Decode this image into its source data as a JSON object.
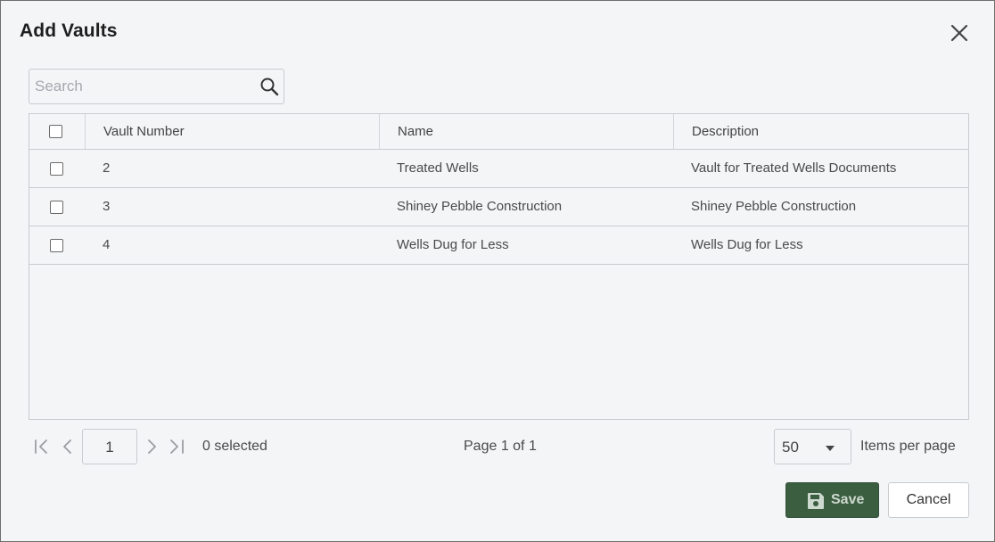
{
  "dialog": {
    "title": "Add Vaults"
  },
  "search": {
    "placeholder": "Search",
    "value": ""
  },
  "table": {
    "columns": [
      "Vault Number",
      "Name",
      "Description"
    ],
    "rows": [
      {
        "vault_number": "2",
        "name": "Treated Wells",
        "description": "Vault for Treated Wells Documents",
        "checked": false
      },
      {
        "vault_number": "3",
        "name": "Shiney Pebble Construction",
        "description": "Shiney Pebble Construction",
        "checked": false
      },
      {
        "vault_number": "4",
        "name": "Wells Dug for Less",
        "description": "Wells Dug for Less",
        "checked": false
      }
    ]
  },
  "pager": {
    "current_page": "1",
    "selected_text": "0 selected",
    "page_info": "Page 1 of 1",
    "items_per_page": "50",
    "items_per_page_label": "Items per page"
  },
  "footer": {
    "save_label": "Save",
    "cancel_label": "Cancel"
  },
  "colors": {
    "primary": "#3b5e40",
    "background": "#f4f5f7",
    "border": "#c9cbcf"
  },
  "icons": [
    "close-icon",
    "search-icon",
    "first-page-icon",
    "prev-page-icon",
    "next-page-icon",
    "last-page-icon",
    "chevron-down-icon",
    "save-icon"
  ]
}
